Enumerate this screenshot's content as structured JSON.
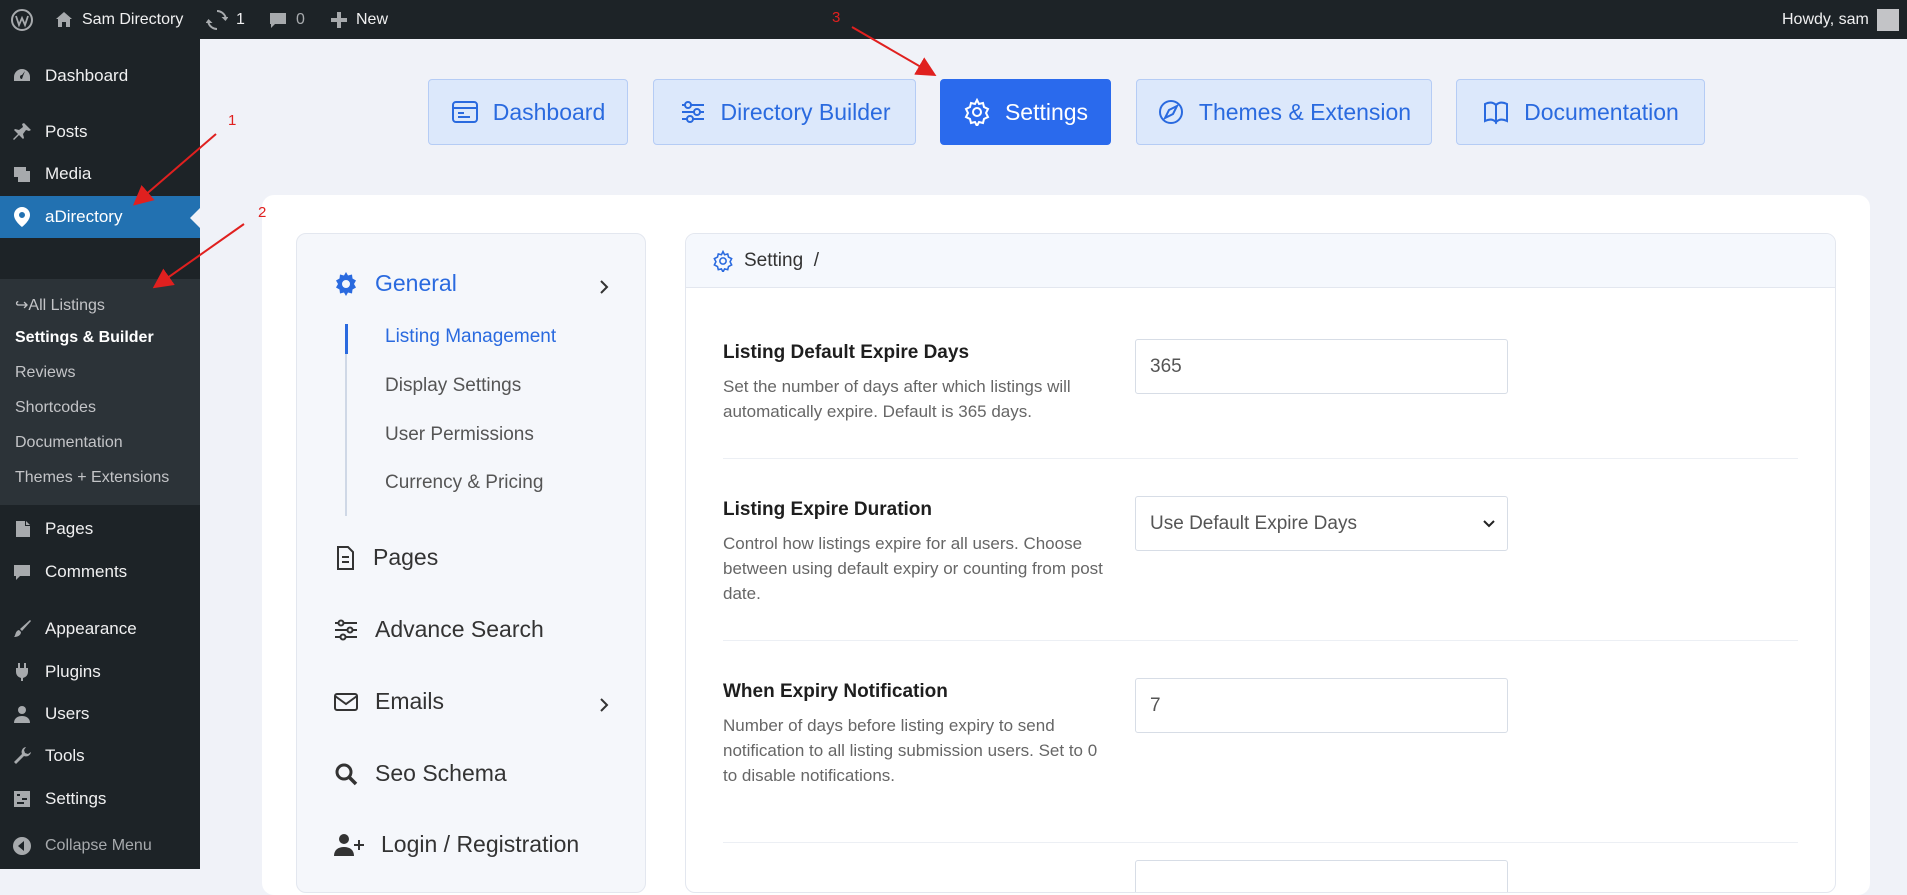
{
  "topbar": {
    "site_name": "Sam Directory",
    "updates_count": "1",
    "comments_count": "0",
    "new_label": "New",
    "greeting": "Howdy, sam"
  },
  "sidebar": {
    "items": [
      {
        "label": "Dashboard",
        "icon": "dashboard-icon"
      },
      {
        "label": "Posts",
        "icon": "pin-icon"
      },
      {
        "label": "Media",
        "icon": "media-icon"
      },
      {
        "label": "aDirectory",
        "icon": "location-icon"
      },
      {
        "label": "Pages",
        "icon": "page-icon"
      },
      {
        "label": "Comments",
        "icon": "comment-icon"
      },
      {
        "label": "Appearance",
        "icon": "brush-icon"
      },
      {
        "label": "Plugins",
        "icon": "plug-icon"
      },
      {
        "label": "Users",
        "icon": "user-icon"
      },
      {
        "label": "Tools",
        "icon": "wrench-icon"
      },
      {
        "label": "Settings",
        "icon": "sliders-icon"
      }
    ],
    "submenu": [
      "↪All Listings",
      "Settings & Builder",
      "Reviews",
      "Shortcodes",
      "Documentation",
      "Themes + Extensions"
    ],
    "collapse_label": "Collapse Menu"
  },
  "tabs": [
    {
      "label": "Dashboard",
      "icon": "dashboard-panel-icon"
    },
    {
      "label": "Directory Builder",
      "icon": "sliders-icon"
    },
    {
      "label": "Settings",
      "icon": "gear-icon"
    },
    {
      "label": "Themes & Extension",
      "icon": "compass-icon"
    },
    {
      "label": "Documentation",
      "icon": "book-icon"
    }
  ],
  "leftnav": {
    "general": "General",
    "general_items": [
      "Listing Management",
      "Display Settings",
      "User Permissions",
      "Currency & Pricing"
    ],
    "sections": [
      "Pages",
      "Advance Search",
      "Emails",
      "Seo Schema",
      "Login / Registration"
    ]
  },
  "panel": {
    "breadcrumb": "Setting  /",
    "fields": [
      {
        "title": "Listing Default Expire Days",
        "desc": "Set the number of days after which listings will automatically expire. Default is 365 days.",
        "value": "365"
      },
      {
        "title": "Listing Expire Duration",
        "desc": "Control how listings expire for all users. Choose between using default expiry or counting from post date.",
        "value": "Use Default Expire Days"
      },
      {
        "title": "When Expiry Notification",
        "desc": "Number of days before listing expiry to send notification to all listing submission users. Set to 0 to disable notifications.",
        "value": "7"
      }
    ]
  },
  "annotations": [
    "1",
    "2",
    "3"
  ]
}
